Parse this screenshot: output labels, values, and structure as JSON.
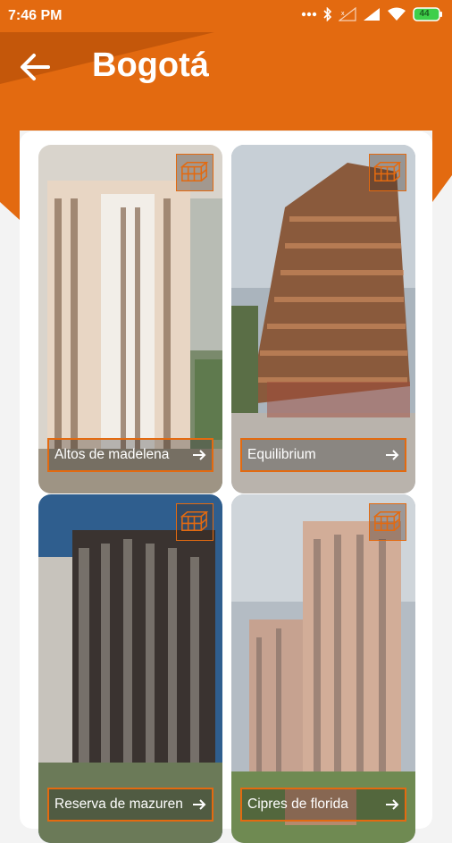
{
  "status_bar": {
    "time": "7:46 PM",
    "battery": "44"
  },
  "header": {
    "title": "Bogotá"
  },
  "colors": {
    "accent": "#e36a10",
    "panel": "#ffffff",
    "background": "#f3f3f3"
  },
  "projects": [
    {
      "name": "Altos de madelena",
      "icon": "building-blocks-icon"
    },
    {
      "name": "Equilibrium",
      "icon": "building-blocks-icon"
    },
    {
      "name": "Reserva de mazuren",
      "icon": "building-blocks-icon"
    },
    {
      "name": "Cipres de florida",
      "icon": "building-blocks-icon"
    }
  ]
}
